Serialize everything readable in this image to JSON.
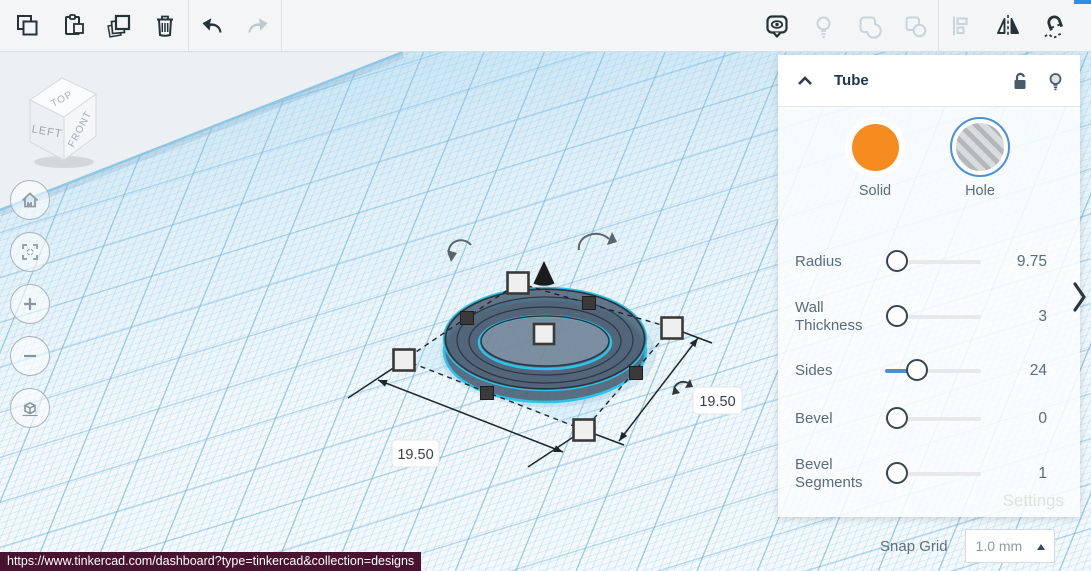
{
  "toolbar": {
    "left_icons": [
      "copy",
      "paste",
      "duplicate",
      "delete",
      "undo",
      "redo"
    ],
    "right_icons": [
      "show-all",
      "light-toggle",
      "group",
      "ungroup",
      "align",
      "mirror",
      "snap-magnet"
    ]
  },
  "inspector": {
    "title": "Tube",
    "header_icons": [
      "collapse-chevron",
      "unlock",
      "light-bulb"
    ],
    "solid_label": "Solid",
    "hole_label": "Hole",
    "selected_mode": "Hole",
    "properties": [
      {
        "label": "Radius",
        "value": "9.75"
      },
      {
        "label": "Wall Thickness",
        "value": "3"
      },
      {
        "label": "Sides",
        "value": "24"
      },
      {
        "label": "Bevel",
        "value": "0"
      },
      {
        "label": "Bevel Segments",
        "value": "1"
      }
    ],
    "settings_label": "Settings"
  },
  "viewcube": {
    "top": "TOP",
    "left": "LEFT",
    "front": "FRONT"
  },
  "scene": {
    "shape": "tube",
    "dimension_width": "19.50",
    "dimension_depth": "19.50"
  },
  "snap_grid": {
    "label": "Snap Grid",
    "value": "1.0 mm"
  },
  "status_url": "https://www.tinkercad.com/dashboard?type=tinkercad&collection=designs",
  "colors": {
    "accent_orange": "#f68b1f",
    "selection_cyan": "#2bc3ea",
    "slider_blue": "#4a90d9",
    "grid_blue": "#8ec7e4",
    "urlbar_maroon": "#48132f"
  }
}
